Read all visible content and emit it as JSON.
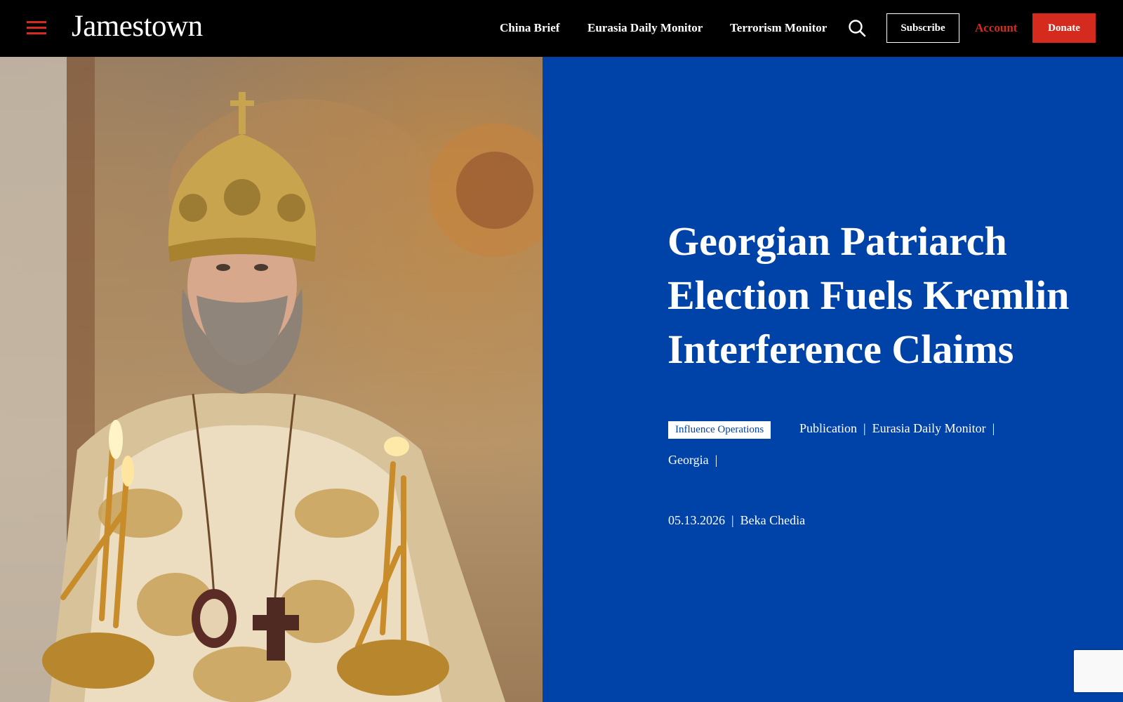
{
  "header": {
    "menu_icon": "hamburger-menu-icon",
    "logo": "Jamestown",
    "nav": [
      {
        "label": "China Brief"
      },
      {
        "label": "Eurasia Daily Monitor"
      },
      {
        "label": "Terrorism Monitor"
      }
    ],
    "search_icon": "search-icon",
    "subscribe_label": "Subscribe",
    "account_label": "Account",
    "donate_label": "Donate"
  },
  "article": {
    "headline_lines": [
      "Georgian Patriarch",
      "Election Fuels Kremlin",
      "Interference Claims"
    ],
    "tag": "Influence Operations",
    "meta_links": [
      "Publication",
      "Eurasia Daily Monitor",
      "Georgia"
    ],
    "date": "05.13.2026",
    "author": "Beka Chedia"
  },
  "colors": {
    "header_bg": "#000000",
    "accent_red": "#d52b1e",
    "panel_blue": "#0043a8",
    "text_white": "#ffffff"
  }
}
